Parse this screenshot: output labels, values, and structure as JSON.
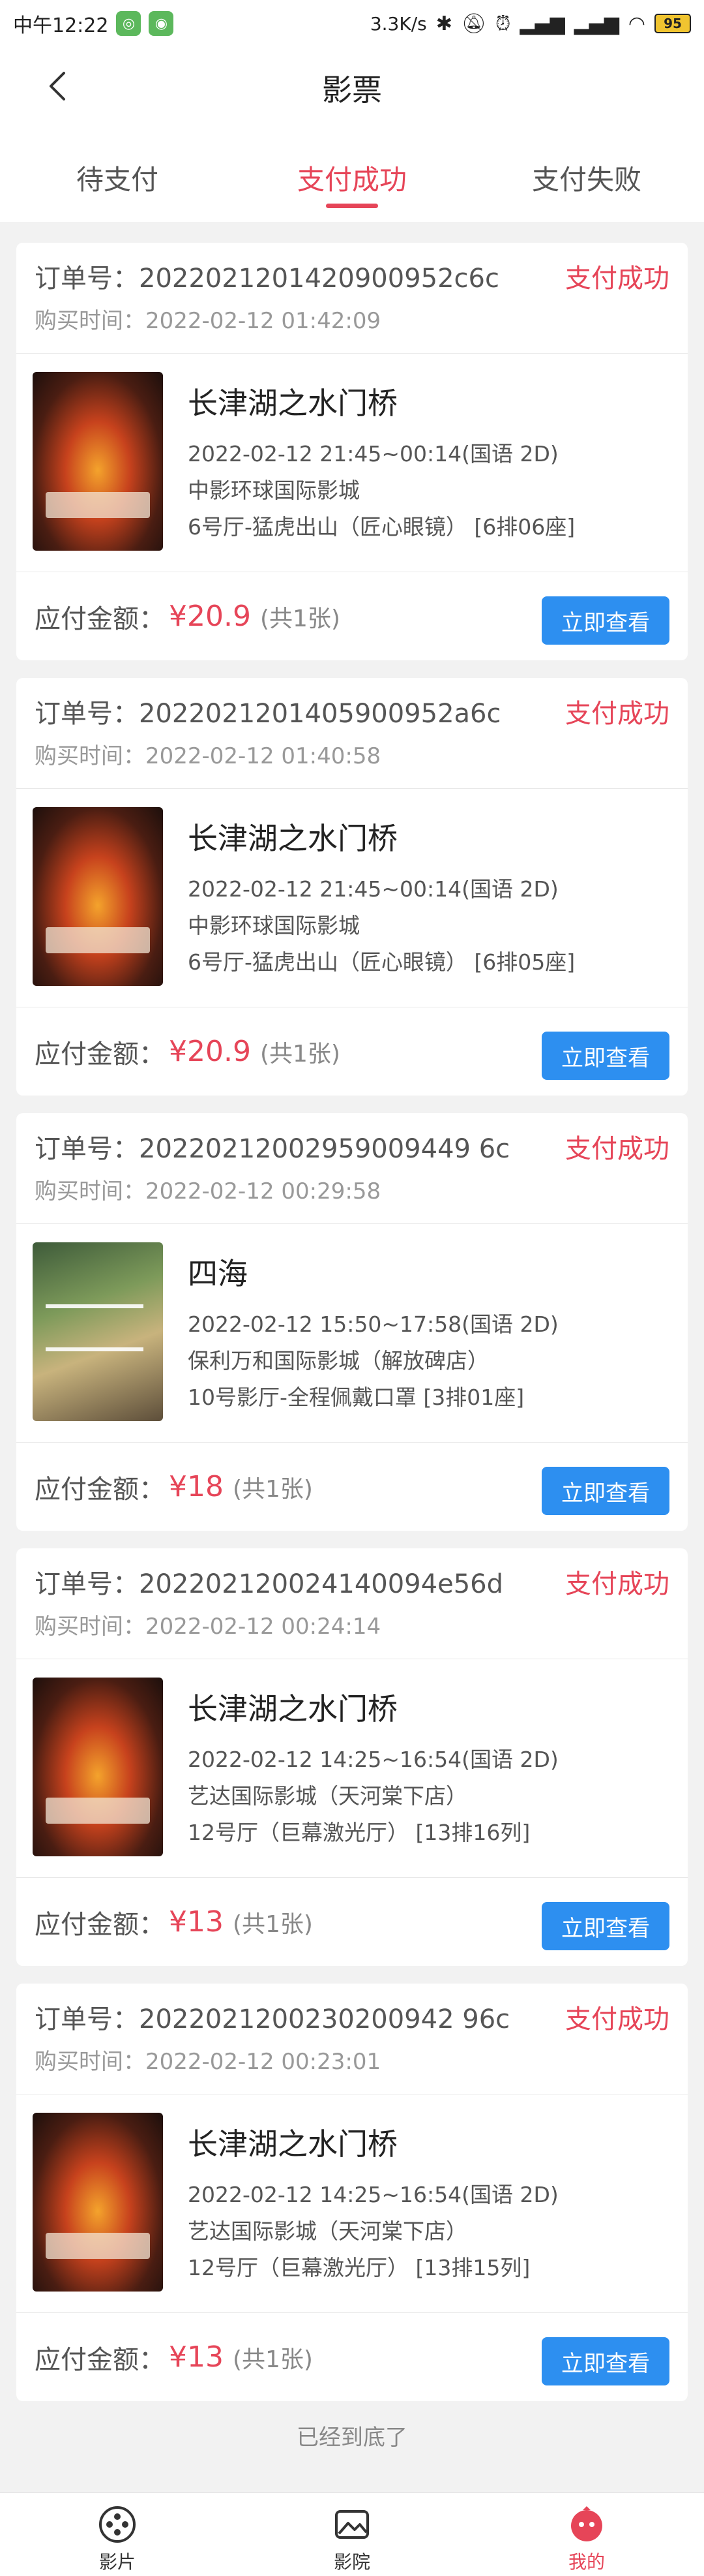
{
  "status_bar": {
    "time": "中午12:22",
    "net_speed": "3.3K/s",
    "battery": "95"
  },
  "header": {
    "title": "影票"
  },
  "tabs": [
    {
      "label": "待支付"
    },
    {
      "label": "支付成功"
    },
    {
      "label": "支付失败"
    }
  ],
  "labels": {
    "order_no_prefix": "订单号：",
    "buy_time_prefix": "购买时间：",
    "pay_label": "应付金额：",
    "view_button": "立即查看"
  },
  "orders": [
    {
      "order_no": "订单号：2022021201420900952c6c",
      "status": "支付成功",
      "buy_time": "购买时间：2022-02-12 01:42:09",
      "movie": "长津湖之水门桥",
      "showtime": "2022-02-12 21:45~00:14(国语 2D)",
      "cinema": "中影环球国际影城",
      "seat": "6号厅-猛虎出山（匠心眼镜） [6排06座]",
      "price": "¥20.9",
      "count": "(共1张)"
    },
    {
      "order_no": "订单号：2022021201405900952a6c",
      "status": "支付成功",
      "buy_time": "购买时间：2022-02-12 01:40:58",
      "movie": "长津湖之水门桥",
      "showtime": "2022-02-12 21:45~00:14(国语 2D)",
      "cinema": "中影环球国际影城",
      "seat": "6号厅-猛虎出山（匠心眼镜） [6排05座]",
      "price": "¥20.9",
      "count": "(共1张)"
    },
    {
      "order_no": "订单号：20220212002959009449 6c",
      "status": "支付成功",
      "buy_time": "购买时间：2022-02-12 00:29:58",
      "movie": "四海",
      "showtime": "2022-02-12 15:50~17:58(国语 2D)",
      "cinema": "保利万和国际影城（解放碑店）",
      "seat": "10号影厅-全程佩戴口罩 [3排01座]",
      "price": "¥18",
      "count": "(共1张)"
    },
    {
      "order_no": "订单号：202202120024140094e56d",
      "status": "支付成功",
      "buy_time": "购买时间：2022-02-12 00:24:14",
      "movie": "长津湖之水门桥",
      "showtime": "2022-02-12 14:25~16:54(国语 2D)",
      "cinema": "艺达国际影城（天河棠下店）",
      "seat": "12号厅（巨幕激光厅） [13排16列]",
      "price": "¥13",
      "count": "(共1张)"
    },
    {
      "order_no": "订单号：2022021200230200942 96c",
      "status": "支付成功",
      "buy_time": "购买时间：2022-02-12 00:23:01",
      "movie": "长津湖之水门桥",
      "showtime": "2022-02-12 14:25~16:54(国语 2D)",
      "cinema": "艺达国际影城（天河棠下店）",
      "seat": "12号厅（巨幕激光厅） [13排15列]",
      "price": "¥13",
      "count": "(共1张)"
    }
  ],
  "bottom_tip": "已经到底了",
  "nav": [
    {
      "label": "影片",
      "icon": "film-reel-icon"
    },
    {
      "label": "影院",
      "icon": "cinema-icon"
    },
    {
      "label": "我的",
      "icon": "profile-icon"
    }
  ],
  "colors": {
    "accent": "#e64558",
    "button": "#2d8ff0"
  }
}
